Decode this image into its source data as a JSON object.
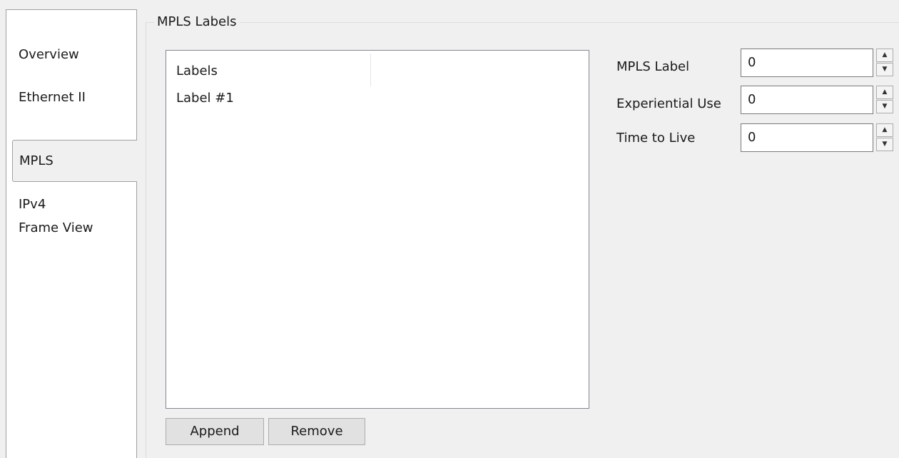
{
  "tabs": [
    {
      "label": "Overview"
    },
    {
      "label": "Ethernet II"
    },
    {
      "label": "MPLS",
      "selected": true
    },
    {
      "label": "IPv4"
    },
    {
      "label": "Frame View"
    }
  ],
  "group": {
    "title": "MPLS Labels"
  },
  "labels_list": {
    "header": "Labels",
    "items": [
      "Label #1"
    ]
  },
  "buttons": {
    "append": "Append",
    "remove": "Remove"
  },
  "fields": {
    "mpls_label": {
      "label": "MPLS Label",
      "value": "0"
    },
    "experiential_use": {
      "label": "Experiential Use",
      "value": "0"
    },
    "time_to_live": {
      "label": "Time to Live",
      "value": "0"
    }
  },
  "icons": {
    "spin_up": "▲",
    "spin_down": "▼"
  }
}
